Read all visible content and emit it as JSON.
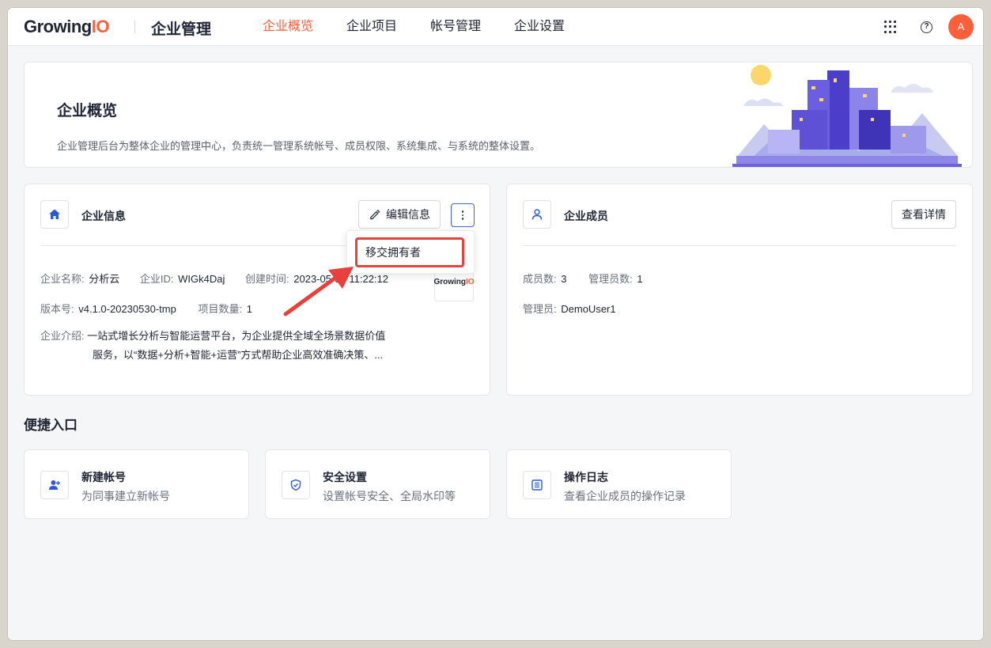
{
  "header": {
    "logo_main": "Growing",
    "logo_accent": "IO",
    "app_name": "企业管理",
    "nav": [
      "企业概览",
      "企业项目",
      "帐号管理",
      "企业设置"
    ],
    "active_nav": "企业概览",
    "help_glyph": "?",
    "avatar_letter": "A",
    "accent_color": "#fc5f3a"
  },
  "banner": {
    "title": "企业概览",
    "description": "企业管理后台为整体企业的管理中心，负责统一管理系统帐号、成员权限、系统集成、与系统的整体设置。"
  },
  "company_info": {
    "title": "企业信息",
    "edit_label": "编辑信息",
    "name_label": "企业名称:",
    "name_value": "分析云",
    "id_label": "企业ID:",
    "id_value": "WIGk4Daj",
    "created_label": "创建时间:",
    "created_value": "2023-05-30 11:22:12",
    "version_label": "版本号:",
    "version_value": "v4.1.0-20230530-tmp",
    "project_count_label": "项目数量:",
    "project_count_value": "1",
    "intro_label": "企业介绍:",
    "intro_line1": "一站式增长分析与智能运营平台，为企业提供全域全场景数据价值",
    "intro_line2": "服务，以“数据+分析+智能+运营”方式帮助企业高效准确决策、...",
    "mini_logo_main": "Growing",
    "mini_logo_accent": "IO",
    "dropdown_item": "移交拥有者"
  },
  "members": {
    "title": "企业成员",
    "detail_label": "查看详情",
    "member_count_label": "成员数:",
    "member_count_value": "3",
    "admin_count_label": "管理员数:",
    "admin_count_value": "1",
    "admin_label": "管理员:",
    "admin_value": "DemoUser1"
  },
  "shortcuts": {
    "title": "便捷入口",
    "items": [
      {
        "title": "新建帐号",
        "desc": "为同事建立新帐号",
        "icon": "add-user-icon"
      },
      {
        "title": "安全设置",
        "desc": "设置帐号安全、全局水印等",
        "icon": "shield-icon"
      },
      {
        "title": "操作日志",
        "desc": "查看企业成员的操作记录",
        "icon": "log-icon"
      }
    ]
  }
}
